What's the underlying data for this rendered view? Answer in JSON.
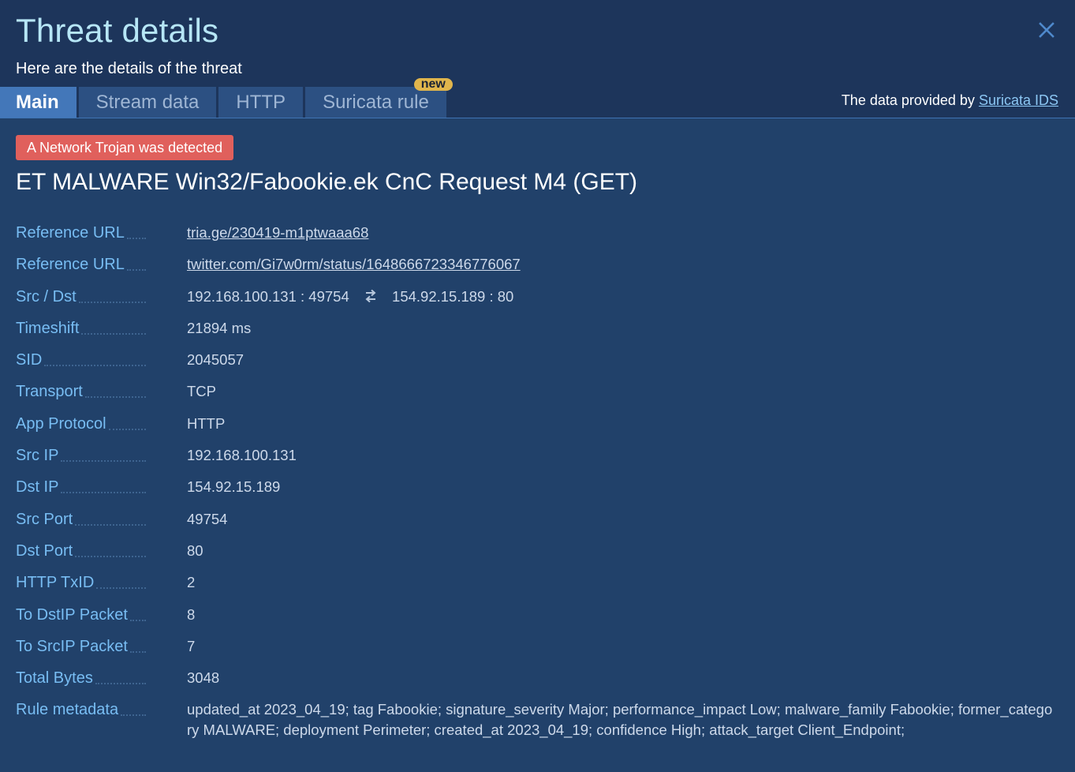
{
  "header": {
    "title": "Threat details",
    "subtitle": "Here are the details of the threat",
    "close_icon": "close-icon"
  },
  "tabs": [
    {
      "label": "Main",
      "active": true
    },
    {
      "label": "Stream data",
      "active": false
    },
    {
      "label": "HTTP",
      "active": false
    },
    {
      "label": "Suricata rule",
      "active": false,
      "badge": "new"
    }
  ],
  "provided": {
    "prefix": "The data provided by",
    "link_label": "Suricata IDS"
  },
  "alert": {
    "badge_label": "A Network Trojan was detected",
    "badge_color": "#e0605c",
    "signature": "ET MALWARE Win32/Fabookie.ek CnC Request M4 (GET)"
  },
  "details": {
    "ref_url_1": {
      "label": "Reference URL",
      "value": "tria.ge/230419-m1ptwaaa68"
    },
    "ref_url_2": {
      "label": "Reference URL",
      "value": "twitter.com/Gi7w0rm/status/1648666723346776067"
    },
    "src_dst": {
      "label": "Src / Dst",
      "src": "192.168.100.131 : 49754",
      "dst": "154.92.15.189 : 80",
      "icon": "swap-arrows-icon"
    },
    "timeshift": {
      "label": "Timeshift",
      "value": "21894 ms"
    },
    "sid": {
      "label": "SID",
      "value": "2045057"
    },
    "transport": {
      "label": "Transport",
      "value": "TCP"
    },
    "app_protocol": {
      "label": "App Protocol",
      "value": "HTTP"
    },
    "src_ip": {
      "label": "Src IP",
      "value": "192.168.100.131"
    },
    "dst_ip": {
      "label": "Dst IP",
      "value": "154.92.15.189"
    },
    "src_port": {
      "label": "Src Port",
      "value": "49754"
    },
    "dst_port": {
      "label": "Dst Port",
      "value": "80"
    },
    "http_txid": {
      "label": "HTTP TxID",
      "value": "2"
    },
    "to_dstip_packet": {
      "label": "To DstIP Packet",
      "value": "8"
    },
    "to_srcip_packet": {
      "label": "To SrcIP Packet",
      "value": "7"
    },
    "total_bytes": {
      "label": "Total Bytes",
      "value": "3048"
    },
    "rule_metadata": {
      "label": "Rule metadata",
      "value": "updated_at 2023_04_19; tag Fabookie; signature_severity Major; performance_impact Low; malware_family Fabookie; former_category MALWARE; deployment Perimeter; created_at 2023_04_19; confidence High; attack_target Client_Endpoint;"
    }
  },
  "colors": {
    "header_bg": "#1d355b",
    "body_bg": "#21416a",
    "title": "#b6e6f6",
    "label": "#78bdf3",
    "active_tab": "#4377b9",
    "new_badge": "#e0b54c"
  }
}
